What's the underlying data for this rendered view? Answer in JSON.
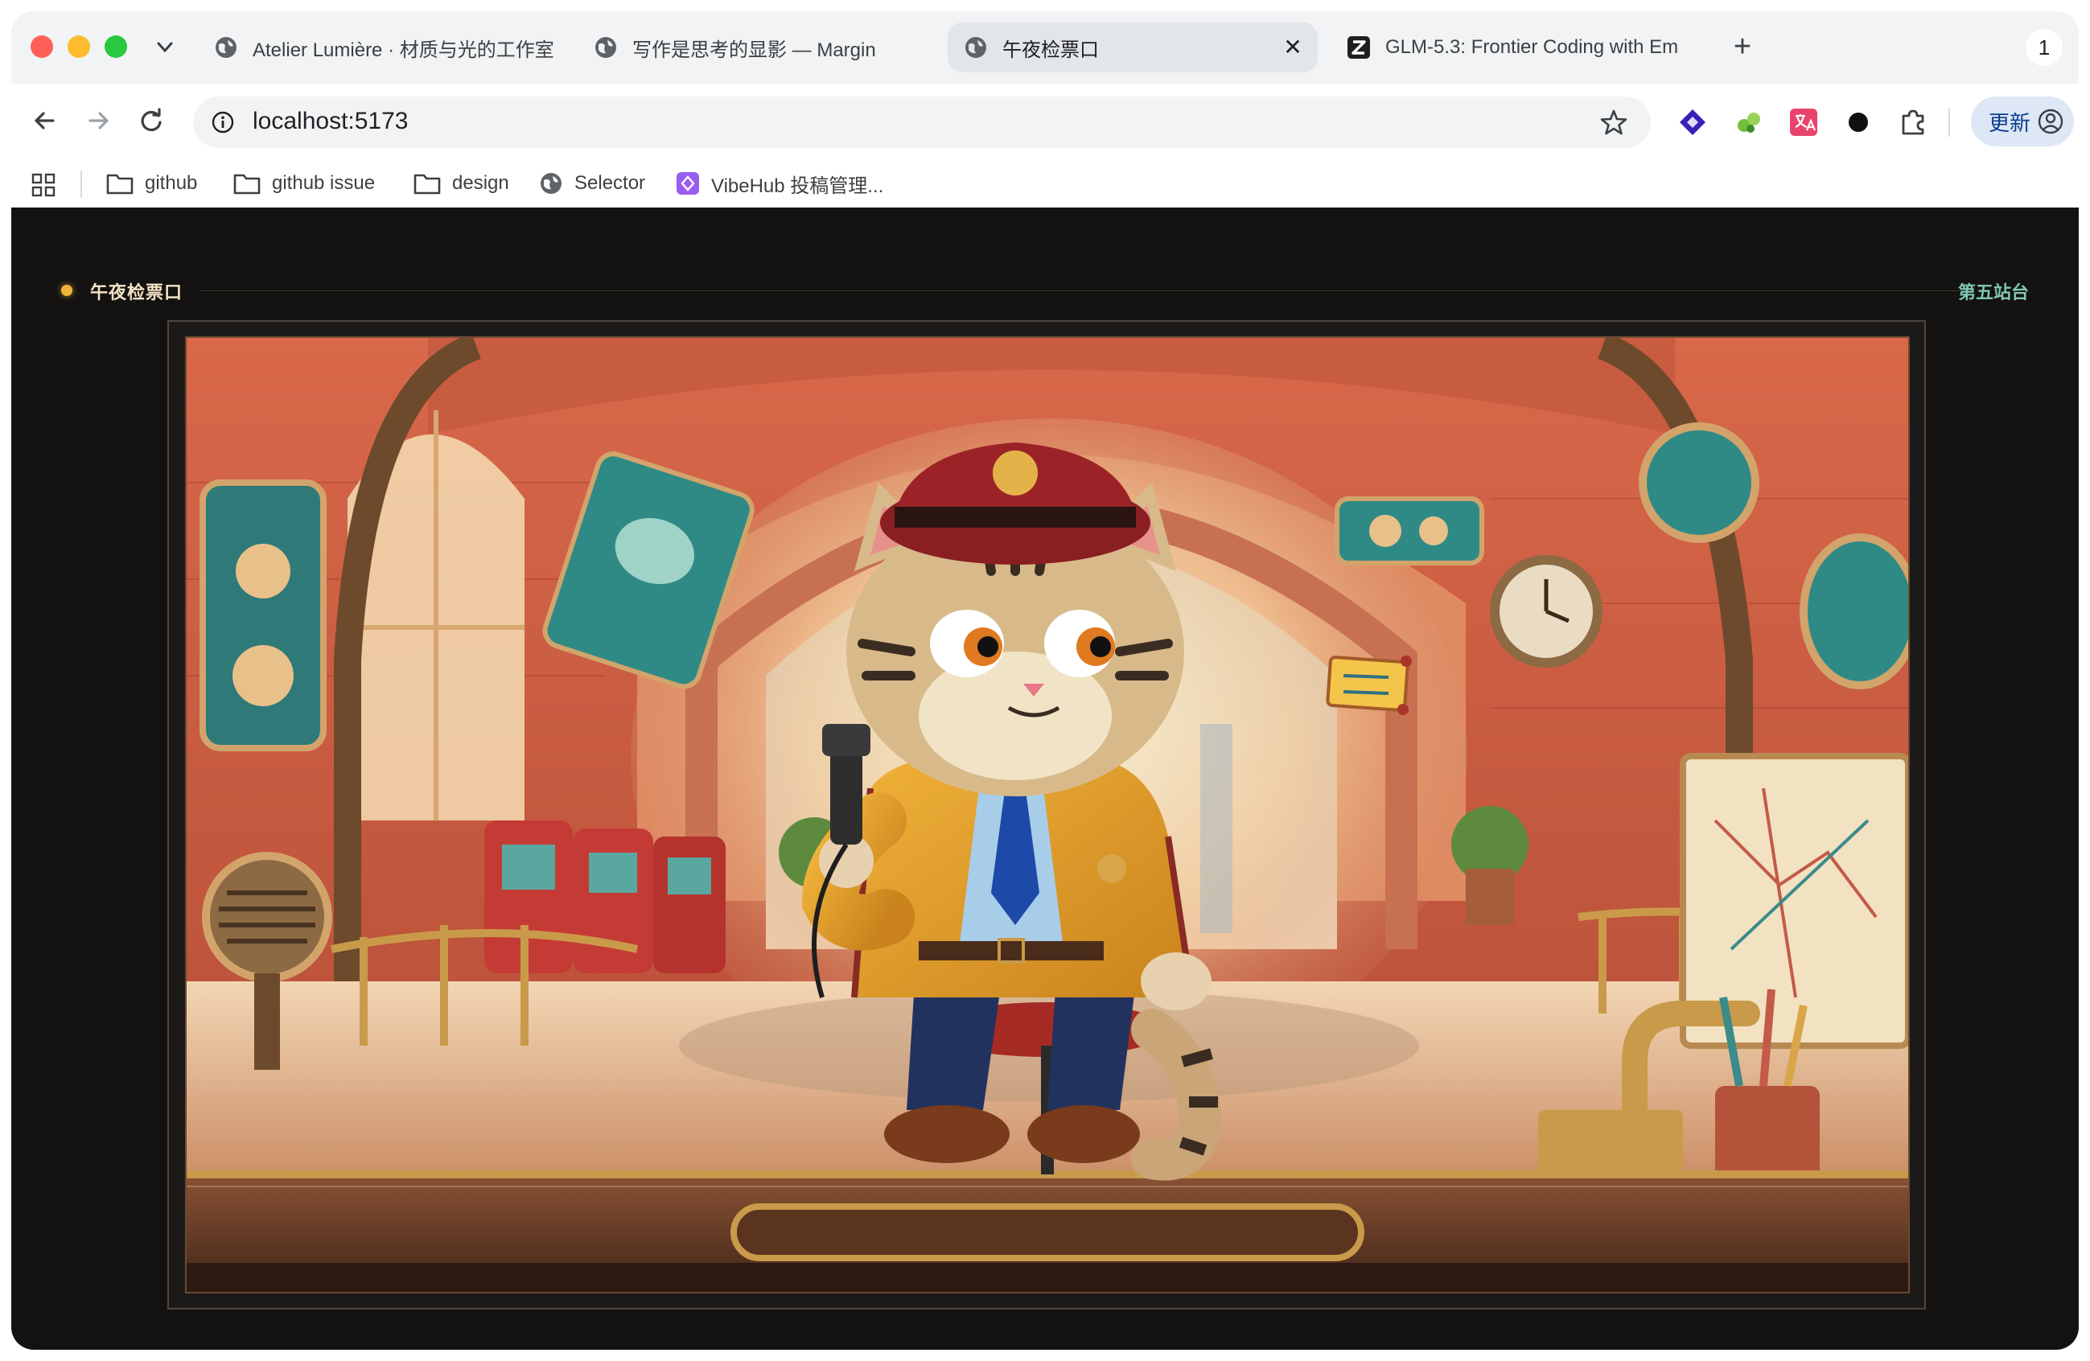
{
  "browser": {
    "tabs": [
      {
        "title": "Atelier Lumière · 材质与光的工作室",
        "active": false,
        "favicon": "globe-icon"
      },
      {
        "title": "写作是思考的显影 — Margin",
        "active": false,
        "favicon": "globe-icon"
      },
      {
        "title": "午夜检票口",
        "active": true,
        "favicon": "globe-icon"
      },
      {
        "title": "GLM-5.3: Frontier Coding with Em",
        "active": false,
        "favicon": "z-logo-icon"
      }
    ],
    "new_tab": "+",
    "close_symbol": "✕",
    "profile_count": "1",
    "address": "localhost:5173",
    "update_label": "更新",
    "extensions": [
      "diamond-extension-icon",
      "puzzle-green-extension-icon",
      "translate-extension-icon",
      "dark-circle-extension-icon",
      "extensions-puzzle-icon"
    ]
  },
  "bookmarks": [
    {
      "label": "github",
      "icon": "folder-icon"
    },
    {
      "label": "github issue",
      "icon": "folder-icon"
    },
    {
      "label": "design",
      "icon": "folder-icon"
    },
    {
      "label": "Selector",
      "icon": "globe-icon"
    },
    {
      "label": "VibeHub 投稿管理...",
      "icon": "vibehub-icon"
    }
  ],
  "page": {
    "title": "午夜检票口",
    "station_label": "第五站台",
    "accent_color": "#f0b43a",
    "station_color": "#7fc6b3"
  },
  "scene": {
    "description_icon": "cat-ticket-inspector-illustration",
    "ticket_icon": "ticket-icon"
  }
}
